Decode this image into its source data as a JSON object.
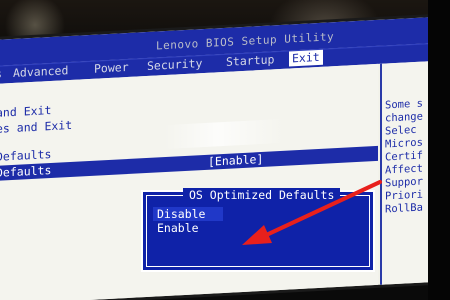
{
  "bios": {
    "title": "Lenovo BIOS Setup Utility",
    "menu": [
      "s",
      "Advanced",
      "Power",
      "Security",
      "Startup",
      "Exit"
    ],
    "active_menu": "Exit"
  },
  "options": {
    "item1": "and Exit",
    "item2": "es and Exit",
    "item3": "Defaults",
    "item4_label": "Defaults",
    "item4_value": "[Enable]"
  },
  "help": {
    "lines": [
      "Some s",
      "change",
      " Selec",
      "Micros",
      "Certif",
      "Affect",
      "Suppor",
      "Priori",
      "RollBa"
    ]
  },
  "popup": {
    "title": "OS Optimized Defaults",
    "options": [
      "Disable",
      "Enable"
    ],
    "selected": "Disable"
  },
  "colors": {
    "bios_blue": "#1d2ca8",
    "screen_bg": "#f4f4ee",
    "arrow_red": "#e8201c"
  }
}
